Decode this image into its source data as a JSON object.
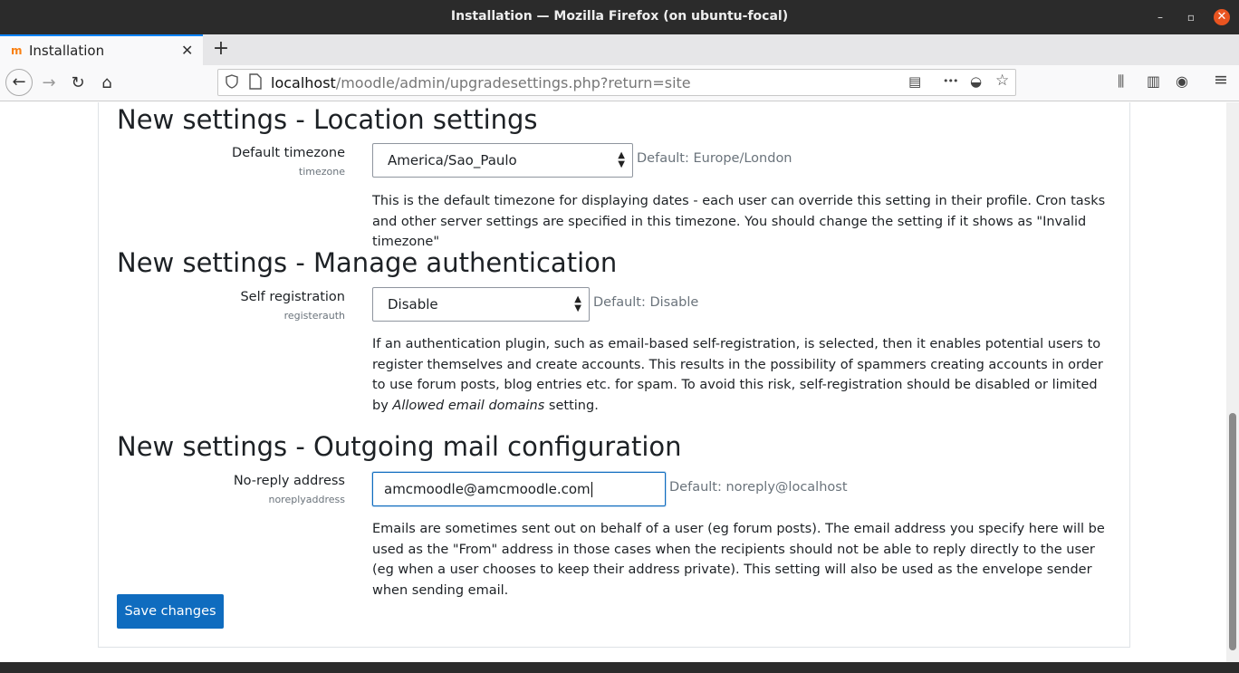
{
  "window": {
    "title": "Installation — Mozilla Firefox (on ubuntu-focal)",
    "minimize": "–",
    "maximize": "▫",
    "close": "✕"
  },
  "tab": {
    "favicon": "m",
    "title": "Installation",
    "close": "✕",
    "new_tab": "+"
  },
  "nav": {
    "back": "←",
    "forward": "→",
    "reload": "↻",
    "home": "⌂",
    "url_host": "localhost",
    "url_path": "/moodle/admin/upgradesettings.php?return=site",
    "reader_icon": "▤",
    "more_icon": "•••",
    "pocket_icon": "◒",
    "star_icon": "☆",
    "library_icon": "⫼",
    "sidebar_icon": "▥",
    "account_icon": "◉",
    "menu_icon": "≡"
  },
  "sections": [
    {
      "heading": "New settings - Location settings",
      "label": "Default timezone",
      "key": "timezone",
      "value": "America/Sao_Paulo",
      "default": "Default: Europe/London",
      "description": "This is the default timezone for displaying dates - each user can override this setting in their profile. Cron tasks and other server settings are specified in this timezone. You should change the setting if it shows as \"Invalid timezone\""
    },
    {
      "heading": "New settings - Manage authentication",
      "label": "Self registration",
      "key": "registerauth",
      "value": "Disable",
      "default": "Default: Disable",
      "description_pre": "If an authentication plugin, such as email-based self-registration, is selected, then it enables potential users to register themselves and create accounts. This results in the possibility of spammers creating accounts in order to use forum posts, blog entries etc. for spam. To avoid this risk, self-registration should be disabled or limited by ",
      "description_em": "Allowed email domains",
      "description_post": " setting."
    },
    {
      "heading": "New settings - Outgoing mail configuration",
      "label": "No-reply address",
      "key": "noreplyaddress",
      "value": "amcmoodle@amcmoodle.com",
      "default": "Default: noreply@localhost",
      "description": "Emails are sometimes sent out on behalf of a user (eg forum posts). The email address you specify here will be used as the \"From\" address in those cases when the recipients should not be able to reply directly to the user (eg when a user chooses to keep their address private). This setting will also be used as the envelope sender when sending email."
    }
  ],
  "save_button": "Save changes",
  "colors": {
    "primary": "#0f6cbf",
    "close_button": "#e95420",
    "titlebar": "#2b2b2b"
  }
}
